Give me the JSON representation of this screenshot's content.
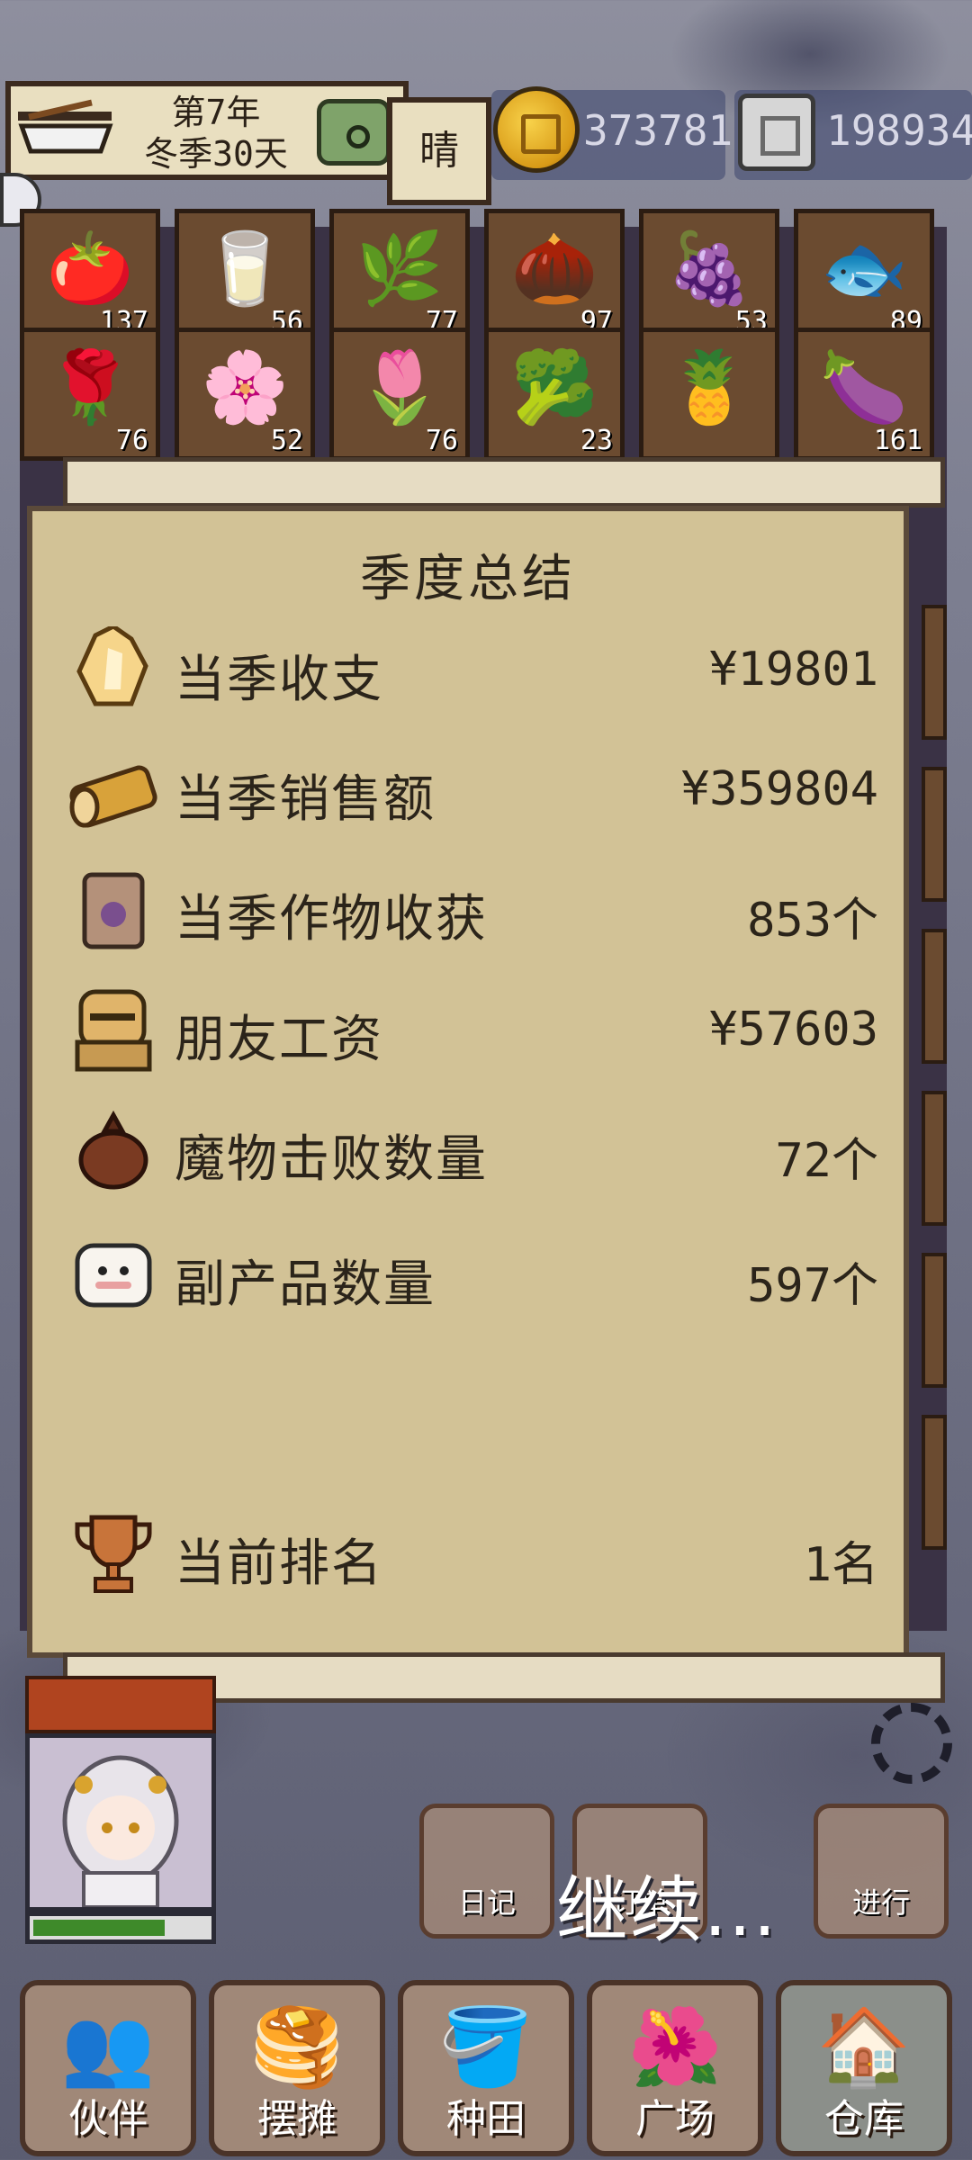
{
  "hud": {
    "year_label": "第7年",
    "season_label": "冬季30天",
    "weather": "晴",
    "coins": "373781",
    "gems": "198934"
  },
  "inventory": {
    "row1": [
      {
        "icon": "tomato-icon",
        "glyph": "🍅",
        "count": "137"
      },
      {
        "icon": "milk-icon",
        "glyph": "🥛",
        "count": "56"
      },
      {
        "icon": "herb-icon",
        "glyph": "🌿",
        "count": "77"
      },
      {
        "icon": "nut-icon",
        "glyph": "🌰",
        "count": "97"
      },
      {
        "icon": "grape-icon",
        "glyph": "🍇",
        "count": "53"
      },
      {
        "icon": "fish-icon",
        "glyph": "🐟",
        "count": "89"
      }
    ],
    "row2": [
      {
        "icon": "rose-icon",
        "glyph": "🌹",
        "count": "76"
      },
      {
        "icon": "orchid-icon",
        "glyph": "🌸",
        "count": "52"
      },
      {
        "icon": "tulip-icon",
        "glyph": "🌷",
        "count": "76"
      },
      {
        "icon": "cauliflower-icon",
        "glyph": "🥦",
        "count": "23"
      },
      {
        "icon": "pineapple-icon",
        "glyph": "🍍",
        "count": ""
      },
      {
        "icon": "eggplant-icon",
        "glyph": "🍆",
        "count": "161"
      }
    ]
  },
  "summary": {
    "title": "季度总结",
    "rows": [
      {
        "icon": "crystal-icon",
        "label": "当季收支",
        "value": "¥19801"
      },
      {
        "icon": "bread-icon",
        "label": "当季销售额",
        "value": "¥359804"
      },
      {
        "icon": "seed-bag-icon",
        "label": "当季作物收获",
        "value": "853个"
      },
      {
        "icon": "worker-icon",
        "label": "朋友工资",
        "value": "¥57603"
      },
      {
        "icon": "loot-bag-icon",
        "label": "魔物击败数量",
        "value": "72个"
      },
      {
        "icon": "sheep-icon",
        "label": "副产品数量",
        "value": "597个"
      }
    ],
    "rank": {
      "icon": "trophy-icon",
      "label": "当前排名",
      "value": "1名"
    }
  },
  "actions": {
    "diary": "日记",
    "orders": "订单",
    "proceed": "进行",
    "continue": "继续..."
  },
  "nav": [
    {
      "icon": "partner-icon",
      "glyph": "👥",
      "label": "伙伴"
    },
    {
      "icon": "stall-icon",
      "glyph": "🥞",
      "label": "摆摊"
    },
    {
      "icon": "watering-can-icon",
      "glyph": "🪣",
      "label": "种田"
    },
    {
      "icon": "plaza-flower-icon",
      "glyph": "🌺",
      "label": "广场"
    },
    {
      "icon": "warehouse-icon",
      "glyph": "🏠",
      "label": "仓库"
    }
  ],
  "character": {
    "hp_fraction": 0.75
  }
}
